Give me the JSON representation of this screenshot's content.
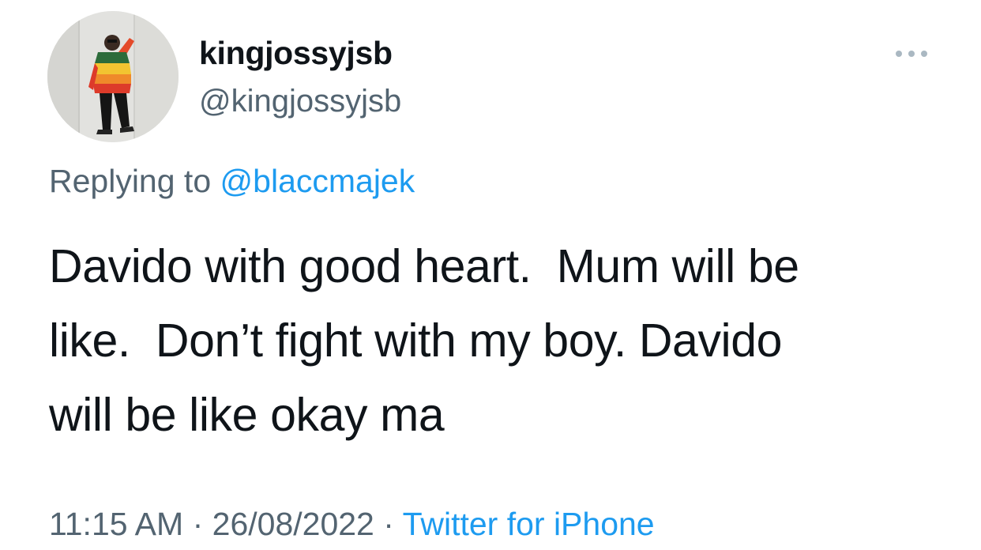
{
  "tweet": {
    "display_name": "kingjossyjsb",
    "handle": "@kingjossyjsb",
    "replying_prefix": "Replying to",
    "replying_to": "@blaccmajek",
    "text_lines": [
      "Davido with good heart.  Mum will be",
      "like.  Don’t fight with my boy. Davido",
      "will be like okay ma"
    ],
    "time": "11:15 AM",
    "separator": "·",
    "date": "26/08/2022",
    "source": "Twitter for iPhone"
  },
  "icons": {
    "more": "more-horizontal-icon",
    "avatar": "profile-photo"
  },
  "colors": {
    "text": "#0f1419",
    "secondary": "#536471",
    "link": "#1d9bf0",
    "background": "#ffffff"
  }
}
